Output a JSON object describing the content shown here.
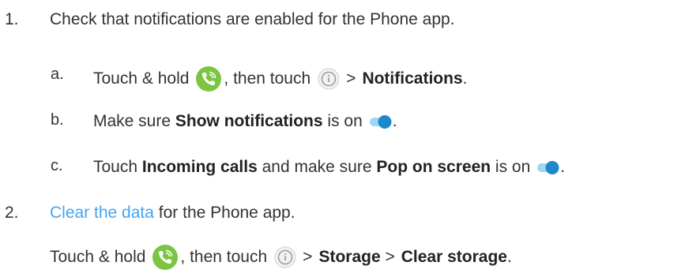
{
  "step1": {
    "number": "1.",
    "text": "Check that notifications are enabled for the Phone app.",
    "sub_a": {
      "letter": "a.",
      "prefix": "Touch & hold",
      "middle": ", then touch",
      "sep": ">",
      "bold": "Notifications",
      "suffix": "."
    },
    "sub_b": {
      "letter": "b.",
      "prefix": "Make sure",
      "bold": "Show notifications",
      "suffix": "is on",
      "end": "."
    },
    "sub_c": {
      "letter": "c.",
      "prefix": "Touch",
      "bold1": "Incoming calls",
      "middle": "and make sure",
      "bold2": "Pop on screen",
      "suffix": "is on",
      "end": "."
    }
  },
  "step2": {
    "number": "2.",
    "link": "Clear the data",
    "text": "for the Phone app.",
    "detail": {
      "prefix": "Touch & hold",
      "middle": ", then touch",
      "sep1": ">",
      "bold1": "Storage",
      "sep2": ">",
      "bold2": "Clear storage",
      "suffix": "."
    }
  },
  "colors": {
    "text": "#333333",
    "link": "#42a5f5",
    "phone_icon": "#7cc542",
    "toggle": "#1e88c9"
  },
  "icons": [
    "phone-app-icon",
    "info-icon",
    "toggle-on-icon"
  ]
}
